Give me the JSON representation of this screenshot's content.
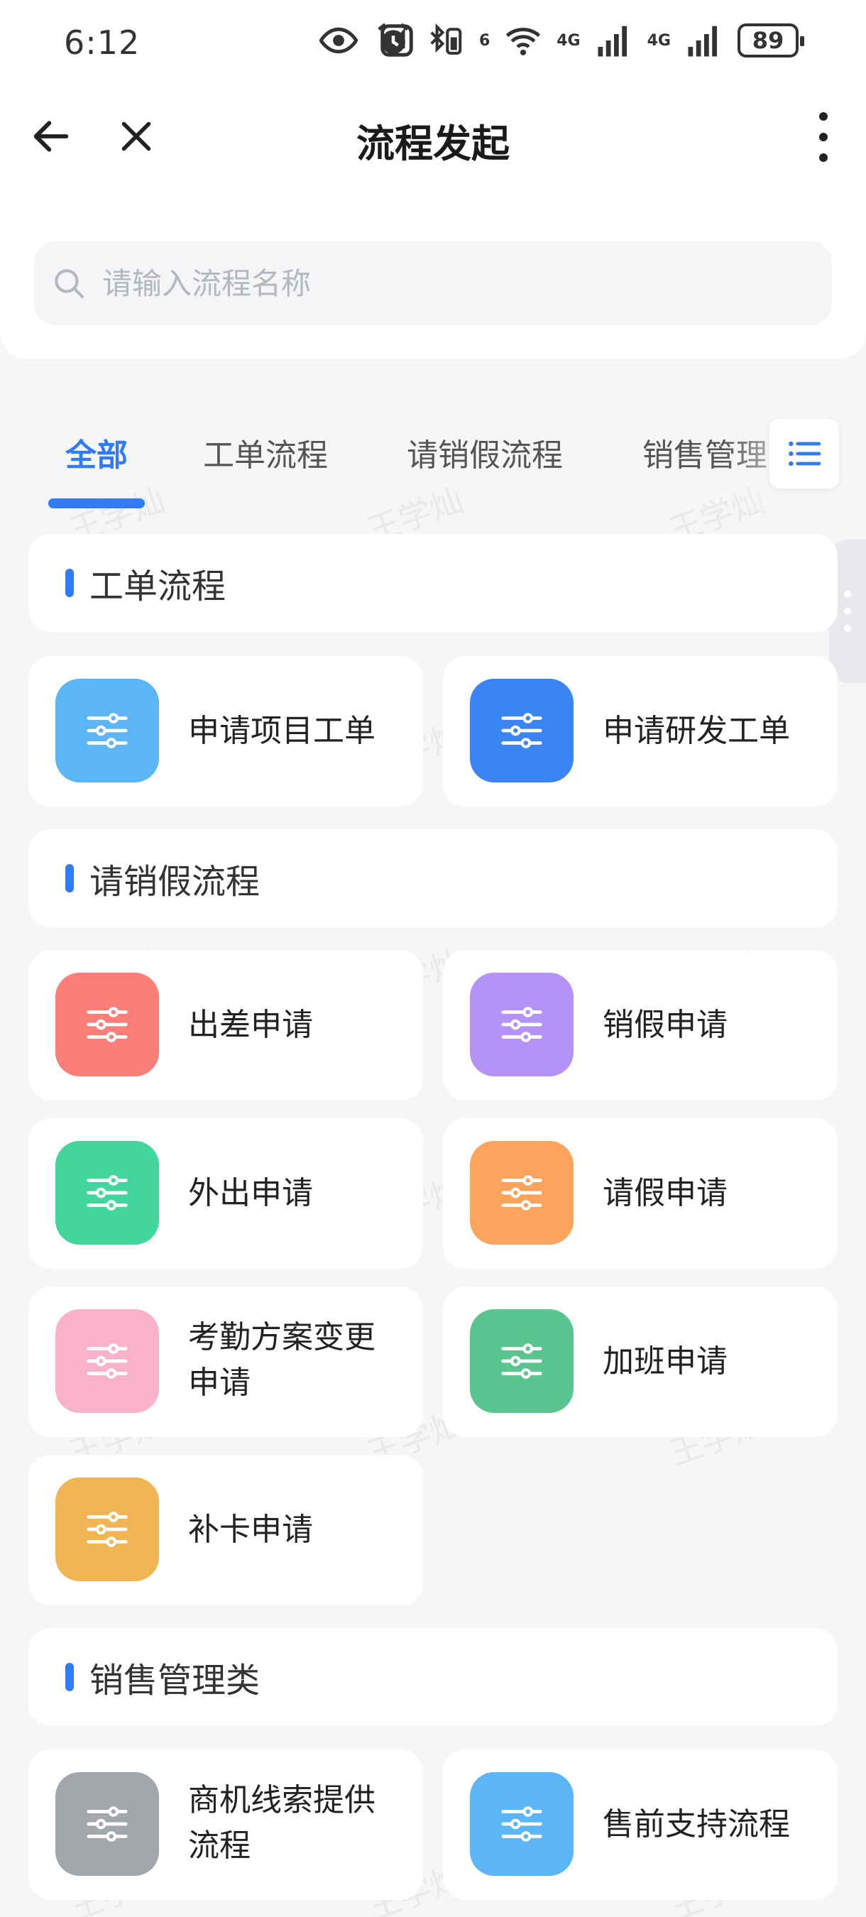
{
  "status_bar": {
    "time": "6:12",
    "network_1": "4G",
    "network_2": "4G",
    "wifi_label": "6",
    "battery": "89"
  },
  "nav": {
    "title": "流程发起"
  },
  "search": {
    "placeholder": "请输入流程名称",
    "value": ""
  },
  "tabs": [
    {
      "label": "全部",
      "active": true
    },
    {
      "label": "工单流程",
      "active": false
    },
    {
      "label": "请销假流程",
      "active": false
    },
    {
      "label": "销售管理",
      "active": false
    }
  ],
  "sections": [
    {
      "title": "工单流程",
      "items": [
        {
          "label": "申请项目工单",
          "color": "#5cb5f7"
        },
        {
          "label": "申请研发工单",
          "color": "#3a84f6"
        }
      ]
    },
    {
      "title": "请销假流程",
      "items": [
        {
          "label": "出差申请",
          "color": "#fb7e78"
        },
        {
          "label": "销假申请",
          "color": "#b592f6"
        },
        {
          "label": "外出申请",
          "color": "#43d69c"
        },
        {
          "label": "请假申请",
          "color": "#fca45c"
        },
        {
          "label": "考勤方案变更申请",
          "color": "#f9b2cc"
        },
        {
          "label": "加班申请",
          "color": "#5bc58f"
        },
        {
          "label": "补卡申请",
          "color": "#f1b653"
        }
      ]
    },
    {
      "title": "销售管理类",
      "items": [
        {
          "label": "商机线索提供流程",
          "color": "#a3a6ab"
        },
        {
          "label": "售前支持流程",
          "color": "#5cb5f7"
        }
      ]
    }
  ],
  "watermark": "王学灿",
  "icons": {
    "back": "arrow-left-icon",
    "close": "close-icon",
    "more": "more-vertical-icon",
    "search": "search-icon",
    "tab_menu": "list-icon",
    "card": "sliders-icon"
  },
  "colors": {
    "accent": "#2f7cf6",
    "background": "#f5f6f8"
  }
}
